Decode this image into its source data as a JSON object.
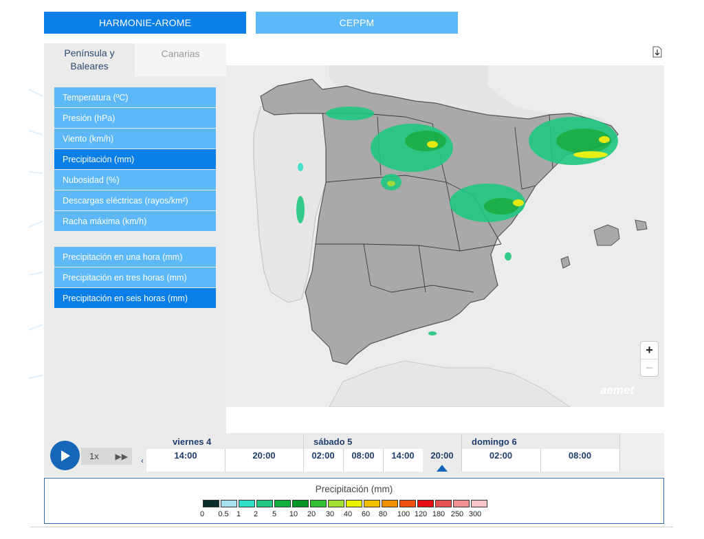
{
  "models": {
    "harmonie": "HARMONIE-AROME",
    "ceppm": "CEPPM"
  },
  "tabs": {
    "peninsula": "Península y Baleares",
    "canarias": "Canarias"
  },
  "variables": [
    {
      "label": "Temperatura (ºC)",
      "active": false
    },
    {
      "label": "Presión (hPa)",
      "active": false
    },
    {
      "label": "Viento (km/h)",
      "active": false
    },
    {
      "label": "Precipitación (mm)",
      "active": true
    },
    {
      "label": "Nubosidad (%)",
      "active": false
    },
    {
      "label": "Descargas eléctricas (rayos/km²)",
      "active": false
    },
    {
      "label": "Racha máxima (km/h)",
      "active": false
    }
  ],
  "accumulations": [
    {
      "label": "Precipitación en una hora (mm)",
      "active": false
    },
    {
      "label": "Precipitación en tres horas (mm)",
      "active": false
    },
    {
      "label": "Precipitación en seis horas (mm)",
      "active": true
    }
  ],
  "map": {
    "zoom_in": "+",
    "zoom_out": "−",
    "watermark": "aemet"
  },
  "player": {
    "speed": "1x",
    "days": [
      "viernes 4",
      "sábado 5",
      "domingo 6"
    ],
    "hours": [
      "14:00",
      "20:00",
      "02:00",
      "08:00",
      "14:00",
      "20:00",
      "02:00",
      "08:00"
    ],
    "selected_hour": "20:00",
    "selected_day": "sábado 5"
  },
  "legend": {
    "title": "Precipitación (mm)",
    "ticks": [
      "0",
      "0.5",
      "1",
      "2",
      "5",
      "10",
      "20",
      "30",
      "40",
      "60",
      "80",
      "100",
      "120",
      "180",
      "250",
      "300"
    ],
    "colors": [
      "#0b2f2f",
      "#a8dff0",
      "#30e0c8",
      "#20c880",
      "#10b040",
      "#089828",
      "#30c030",
      "#a0e030",
      "#e8f000",
      "#f0c000",
      "#f09000",
      "#f05010",
      "#e81010",
      "#e85050",
      "#f09090",
      "#f8c8c8"
    ]
  }
}
